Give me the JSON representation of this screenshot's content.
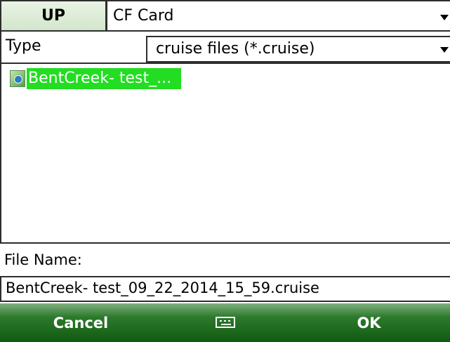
{
  "toolbar": {
    "up_label": "UP",
    "location_value": "CF Card"
  },
  "type_row": {
    "label": "Type",
    "value": "cruise files (*.cruise)"
  },
  "file_list": {
    "items": [
      {
        "label": "BentCreek- test_...",
        "selected": true,
        "icon": "cruise-file-icon"
      }
    ]
  },
  "file_name": {
    "label": "File Name:",
    "value": "BentCreek- test_09_22_2014_15_59.cruise"
  },
  "softkeys": {
    "left_label": "Cancel",
    "center_icon": "keyboard-icon",
    "right_label": "OK"
  },
  "colors": {
    "selection": "#22dd22",
    "softkey_bar": "#1f6b1f",
    "up_button": "#d9ead3"
  }
}
